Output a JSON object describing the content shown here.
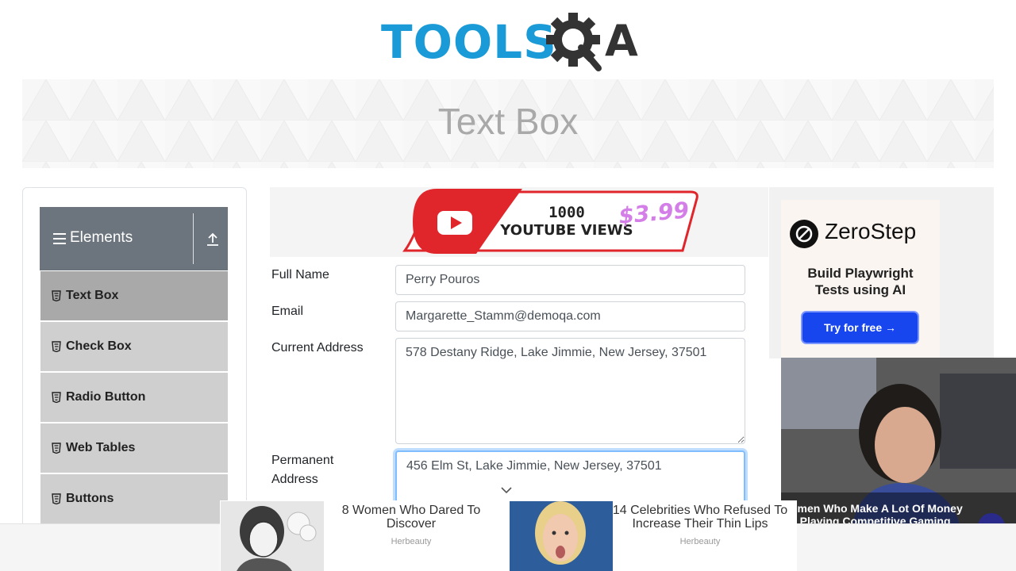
{
  "logo": {
    "text": "TOOLS",
    "qa_text": "A"
  },
  "banner": {
    "title": "Text Box"
  },
  "sidebar": {
    "group_title": "Elements",
    "items": [
      {
        "label": "Text Box",
        "active": true
      },
      {
        "label": "Check Box",
        "active": false
      },
      {
        "label": "Radio Button",
        "active": false
      },
      {
        "label": "Web Tables",
        "active": false
      },
      {
        "label": "Buttons",
        "active": false
      }
    ]
  },
  "yt_ad": {
    "line1": "1000",
    "line2": "YOUTUBE VIEWS",
    "price": "$3.99"
  },
  "form": {
    "full_name_label": "Full Name",
    "full_name_value": "Perry Pouros",
    "email_label": "Email",
    "email_value": "Margarette_Stamm@demoqa.com",
    "current_address_label": "Current Address",
    "current_address_value": "578 Destany Ridge, Lake Jimmie, New Jersey, 37501",
    "permanent_address_label_1": "Permanent",
    "permanent_address_label_2": "Address",
    "permanent_address_value": "456 Elm St, Lake Jimmie, New Jersey, 37501"
  },
  "zerostep_ad": {
    "brand": "ZeroStep",
    "tagline_1": "Build Playwright",
    "tagline_2": "Tests using AI",
    "button": "Try for free →"
  },
  "video_ad": {
    "caption_1": "omen Who Make A Lot Of Money",
    "caption_2": "y Playing Competitive Gaming"
  },
  "bottom_ads": [
    {
      "title": "8 Women Who Dared To Discover",
      "source": "Herbeauty"
    },
    {
      "title": "14 Celebrities Who Refused To Increase Their Thin Lips",
      "source": "Herbeauty"
    }
  ],
  "colors": {
    "brand_blue": "#1a9ad6",
    "sidebar_header": "#6c757d",
    "active_item": "#a9a9a9",
    "focus": "#80bdff"
  }
}
